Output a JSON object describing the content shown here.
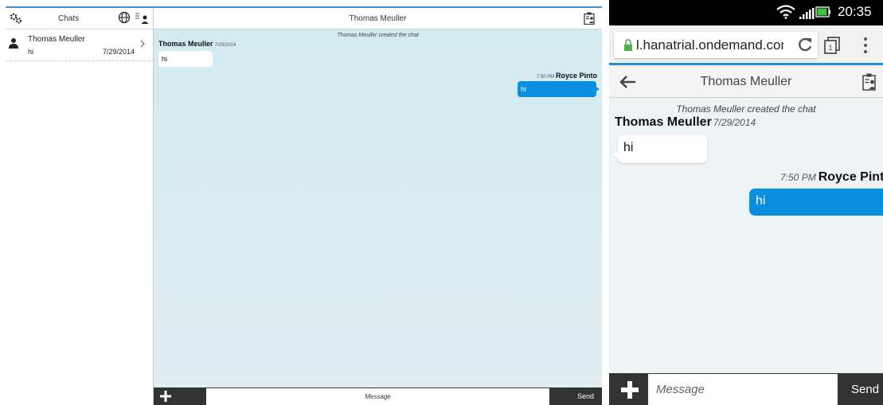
{
  "desktop": {
    "master": {
      "title": "Chats",
      "chat_item": {
        "name": "Thomas Meuller",
        "last_message": "hi",
        "date": "7/29/2014"
      }
    },
    "detail": {
      "title": "Thomas Meuller",
      "created_note": "Thomas Meuller created the chat",
      "incoming": {
        "sender": "Thomas Meuller",
        "date": "7/29/2014",
        "text": "hi"
      },
      "outgoing": {
        "time": "7:50 PM",
        "sender": "Royce Pinto",
        "text": "hi"
      },
      "footer": {
        "placeholder": "Message",
        "send_label": "Send"
      }
    },
    "accent_color": "#4b8fd1",
    "bubble_color": "#0a8ee0"
  },
  "mobile": {
    "status_bar": {
      "time": "20:35"
    },
    "browser": {
      "url": "l.hanatrial.ondemand.com/r"
    },
    "nav": {
      "title": "Thomas Meuller"
    },
    "chat": {
      "created_note": "Thomas Meuller created the chat",
      "incoming": {
        "sender": "Thomas Meuller",
        "date": "7/29/2014",
        "text": "hi"
      },
      "outgoing": {
        "time": "7:50 PM",
        "sender": "Royce Pinto",
        "text": "hi"
      }
    },
    "footer": {
      "placeholder": "Message",
      "send_label": "Send"
    }
  },
  "icons": [
    "gear-icon",
    "globe-icon",
    "contacts-icon",
    "person-icon",
    "chevron-right-icon",
    "clipboard-icon",
    "plus-icon",
    "wifi-icon",
    "signal-icon",
    "battery-icon",
    "lock-icon",
    "reload-icon",
    "tabs-icon",
    "menu-icon",
    "back-arrow-icon"
  ]
}
